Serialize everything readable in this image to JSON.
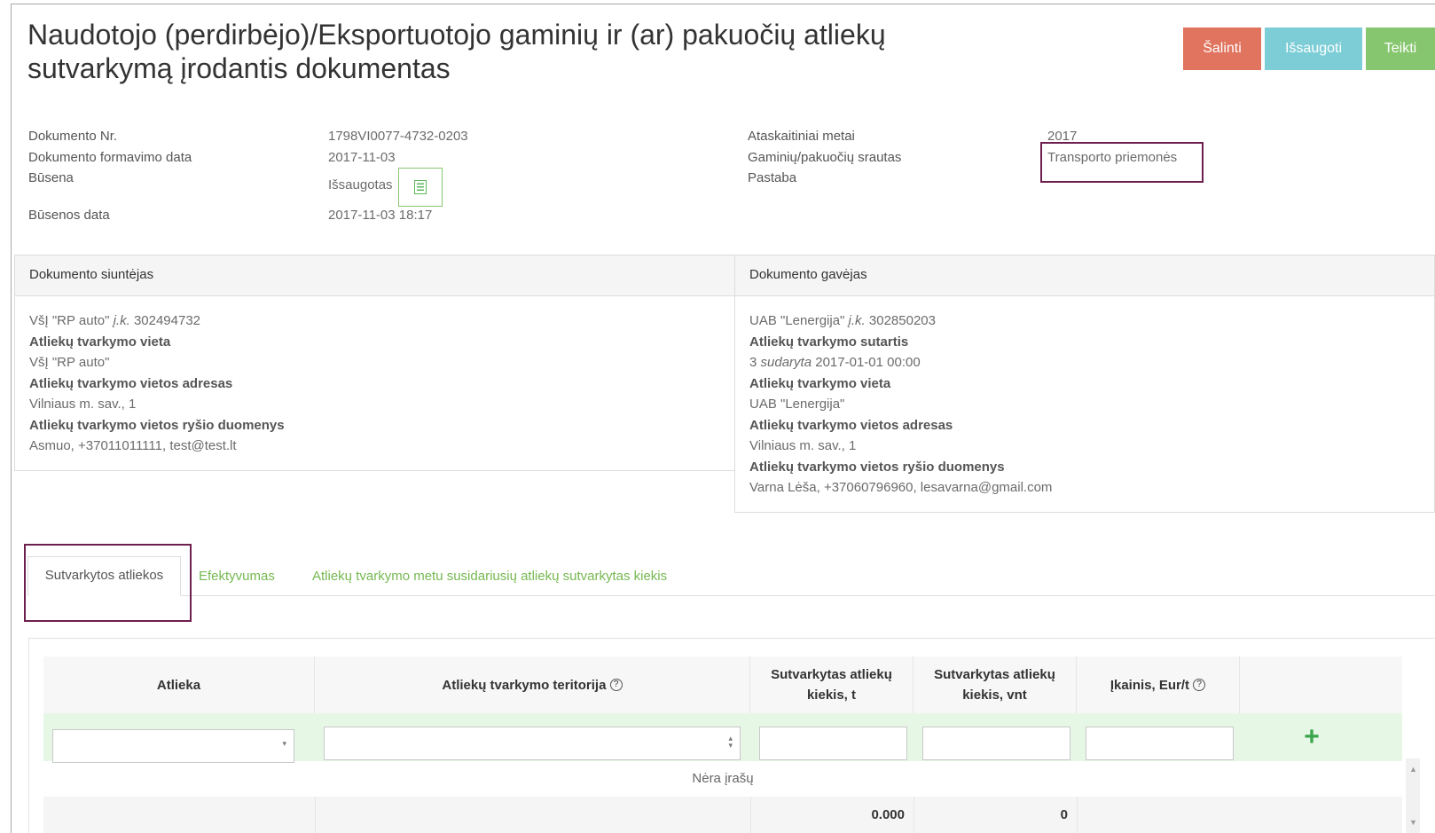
{
  "header": {
    "title": "Naudotojo (perdirbėjo)/Eksportuotojo gaminių ir (ar) pakuočių atliekų sutvarkymą įrodantis dokumentas",
    "buttons": {
      "delete": "Šalinti",
      "save": "Išsaugoti",
      "submit": "Teikti"
    },
    "colors": {
      "delete": "#e0745e",
      "save": "#7ccdd6",
      "submit": "#86c66e"
    }
  },
  "meta": {
    "doc_no_label": "Dokumento Nr.",
    "doc_no": "1798VI0077-4732-0203",
    "formed_label": "Dokumento formavimo data",
    "formed": "2017-11-03",
    "status_label": "Būsena",
    "status": "Išsaugotas",
    "status_icon": "document-list-icon",
    "status_date_label": "Būsenos data",
    "status_date": "2017-11-03 18:17",
    "year_label": "Ataskaitiniai metai",
    "year": "2017",
    "stream_label": "Gaminių/pakuočių srautas",
    "stream": "Transporto priemonės",
    "note_label": "Pastaba"
  },
  "sender": {
    "heading": "Dokumento siuntėjas",
    "name": "VšĮ \"RP auto\"",
    "code_prefix": "į.k.",
    "code": "302494732",
    "site_label": "Atliekų tvarkymo vieta",
    "site": "VšĮ \"RP auto\"",
    "address_label": "Atliekų tvarkymo vietos adresas",
    "address": "Vilniaus m. sav., 1",
    "contacts_label": "Atliekų tvarkymo vietos ryšio duomenys",
    "contacts": "Asmuo, +37011011111, test@test.lt"
  },
  "receiver": {
    "heading": "Dokumento gavėjas",
    "name": "UAB \"Lenergija\"",
    "code_prefix": "į.k.",
    "code": "302850203",
    "contract_label": "Atliekų tvarkymo sutartis",
    "contract_no": "3",
    "contract_signed": "sudaryta",
    "contract_date": "2017-01-01 00:00",
    "site_label": "Atliekų tvarkymo vieta",
    "site": "UAB \"Lenergija\"",
    "address_label": "Atliekų tvarkymo vietos adresas",
    "address": "Vilniaus m. sav., 1",
    "contacts_label": "Atliekų tvarkymo vietos ryšio duomenys",
    "contacts": "Varna Lėša, +37060796960, lesavarna@gmail.com"
  },
  "tabs": [
    {
      "label": "Sutvarkytos atliekos",
      "active": true
    },
    {
      "label": "Efektyvumas",
      "active": false
    },
    {
      "label": "Atliekų tvarkymo metu susidariusių atliekų sutvarkytas kiekis",
      "active": false
    }
  ],
  "table": {
    "columns": [
      "Atlieka",
      "Atliekų tvarkymo teritorija",
      "Sutvarkytas atliekų kiekis, t",
      "Sutvarkytas atliekų kiekis, vnt",
      "Įkainis, Eur/t",
      ""
    ],
    "help_icon": "question-circle-icon",
    "add_icon": "plus-icon",
    "empty_text": "Nėra įrašų",
    "totals": {
      "tons": "0.000",
      "units": "0"
    }
  }
}
